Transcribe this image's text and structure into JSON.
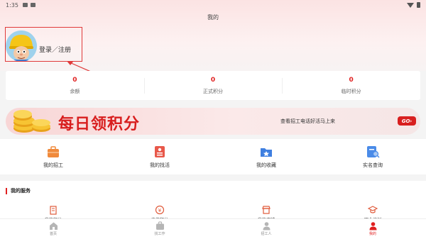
{
  "status_bar": {
    "time": "1:35"
  },
  "header": {
    "title": "我的"
  },
  "profile": {
    "login_text": "登录／注册"
  },
  "stats": [
    {
      "value": "0",
      "label": "余额"
    },
    {
      "value": "0",
      "label": "正式积分"
    },
    {
      "value": "0",
      "label": "临时积分"
    }
  ],
  "banner": {
    "title": "每日领积分",
    "subtitle": "查看招工电话好活马上来",
    "go_label": "GO"
  },
  "quick_actions": [
    {
      "label": "我的招工",
      "icon": "briefcase-icon",
      "color": "#f08a3c"
    },
    {
      "label": "我的找活",
      "icon": "resume-icon",
      "color": "#e8584a"
    },
    {
      "label": "我的收藏",
      "icon": "folder-star-icon",
      "color": "#3f7fe0"
    },
    {
      "label": "实名查询",
      "icon": "id-search-icon",
      "color": "#4a8be8"
    }
  ],
  "services": {
    "title": "我的服务",
    "items": [
      {
        "label": "我的积分",
        "icon": "building-icon"
      },
      {
        "label": "充值积分",
        "icon": "yuan-icon"
      },
      {
        "label": "我的店铺",
        "icon": "shop-icon"
      },
      {
        "label": "职业培训",
        "icon": "graduation-icon"
      }
    ]
  },
  "bottom_nav": [
    {
      "label": "首页",
      "icon": "home-icon",
      "active": false
    },
    {
      "label": "找工作",
      "icon": "work-icon",
      "active": false
    },
    {
      "label": "招工人",
      "icon": "worker-icon",
      "active": false
    },
    {
      "label": "我的",
      "icon": "user-icon",
      "active": true
    }
  ],
  "colors": {
    "accent": "#e02020",
    "annotation": "#e03a3a"
  }
}
